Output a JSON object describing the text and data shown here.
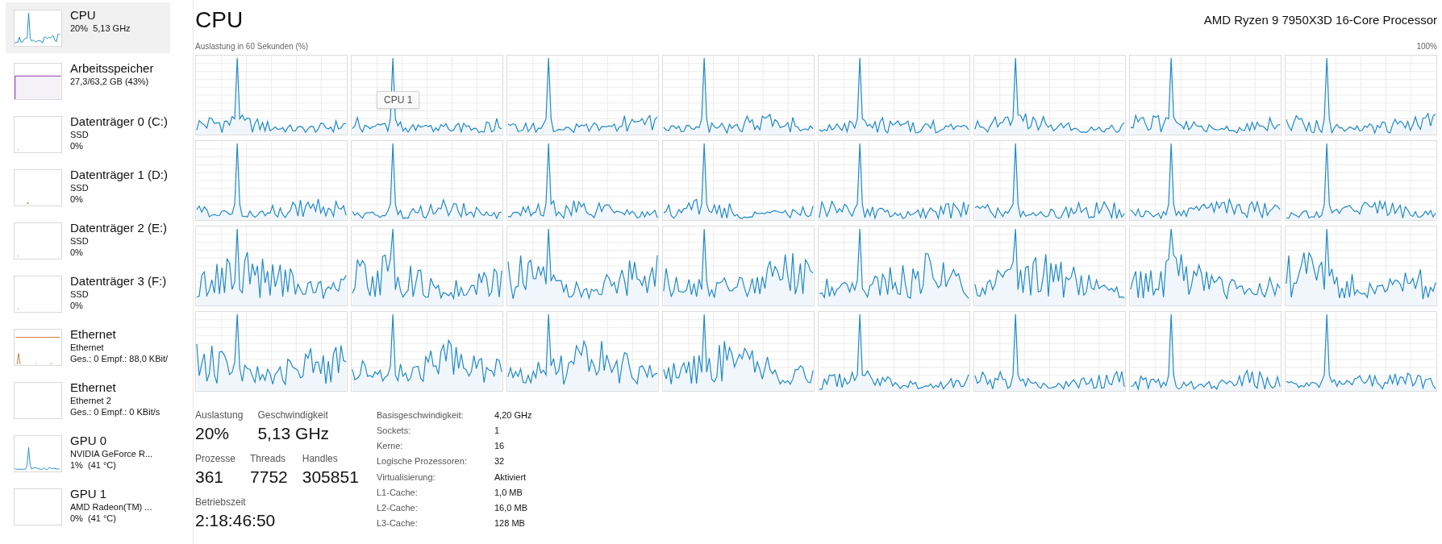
{
  "sidebar": {
    "items": [
      {
        "kind": "cpu",
        "title": "CPU",
        "lines": [
          "20%  5,13 GHz"
        ],
        "selected": true
      },
      {
        "kind": "memory",
        "title": "Arbeitsspeicher",
        "lines": [
          "27,3/63,2 GB (43%)"
        ],
        "selected": false
      },
      {
        "kind": "disk",
        "title": "Datenträger 0 (C:)",
        "lines": [
          "SSD",
          "0%"
        ],
        "selected": false
      },
      {
        "kind": "disk-blip",
        "title": "Datenträger 1 (D:)",
        "lines": [
          "SSD",
          "0%"
        ],
        "selected": false
      },
      {
        "kind": "disk",
        "title": "Datenträger 2 (E:)",
        "lines": [
          "SSD",
          "0%"
        ],
        "selected": false
      },
      {
        "kind": "disk",
        "title": "Datenträger 3 (F:)",
        "lines": [
          "SSD",
          "0%"
        ],
        "selected": false
      },
      {
        "kind": "network",
        "title": "Ethernet",
        "lines": [
          "Ethernet",
          "Ges.: 0 Empf.: 88,0 KBit/"
        ],
        "selected": false
      },
      {
        "kind": "idle",
        "title": "Ethernet",
        "lines": [
          "Ethernet 2",
          "Ges.: 0 Empf.: 0 KBit/s"
        ],
        "selected": false
      },
      {
        "kind": "gpu",
        "title": "GPU 0",
        "lines": [
          "NVIDIA GeForce R...",
          "1%  (41 °C)"
        ],
        "selected": false
      },
      {
        "kind": "idle",
        "title": "GPU 1",
        "lines": [
          "AMD Radeon(TM) ...",
          "0%  (41 °C)"
        ],
        "selected": false
      }
    ]
  },
  "header": {
    "title": "CPU",
    "processor": "AMD Ryzen 9 7950X3D 16-Core Processor",
    "graph_caption": "Auslastung in 60 Sekunden (%)",
    "graph_max": "100%"
  },
  "core_graphs": [
    {
      "kind": "light"
    },
    {
      "kind": "light",
      "tooltip": "CPU 1"
    },
    {
      "kind": "light"
    },
    {
      "kind": "light"
    },
    {
      "kind": "light"
    },
    {
      "kind": "light"
    },
    {
      "kind": "light"
    },
    {
      "kind": "light"
    },
    {
      "kind": "light"
    },
    {
      "kind": "light"
    },
    {
      "kind": "light"
    },
    {
      "kind": "light"
    },
    {
      "kind": "light"
    },
    {
      "kind": "light"
    },
    {
      "kind": "light"
    },
    {
      "kind": "light"
    },
    {
      "kind": "heavy"
    },
    {
      "kind": "heavy"
    },
    {
      "kind": "heavy"
    },
    {
      "kind": "heavy"
    },
    {
      "kind": "heavy"
    },
    {
      "kind": "heavy"
    },
    {
      "kind": "heavy"
    },
    {
      "kind": "heavy"
    },
    {
      "kind": "heavy"
    },
    {
      "kind": "heavy"
    },
    {
      "kind": "heavy"
    },
    {
      "kind": "heavy"
    },
    {
      "kind": "light"
    },
    {
      "kind": "light"
    },
    {
      "kind": "light"
    },
    {
      "kind": "light"
    }
  ],
  "stats": {
    "rows": [
      [
        {
          "label": "Auslastung",
          "value": "20%"
        },
        {
          "label": "Geschwindigkeit",
          "value": "5,13 GHz"
        }
      ],
      [
        {
          "label": "Prozesse",
          "value": "361"
        },
        {
          "label": "Threads",
          "value": "7752"
        },
        {
          "label": "Handles",
          "value": "305851"
        }
      ],
      [
        {
          "label": "Betriebszeit",
          "value": "2:18:46:50"
        }
      ]
    ],
    "details": [
      {
        "label": "Basisgeschwindigkeit:",
        "value": "4,20 GHz"
      },
      {
        "label": "Sockets:",
        "value": "1"
      },
      {
        "label": "Kerne:",
        "value": "16"
      },
      {
        "label": "Logische Prozessoren:",
        "value": "32"
      },
      {
        "label": "Virtualisierung:",
        "value": "Aktiviert"
      },
      {
        "label": "L1-Cache:",
        "value": "1,0 MB"
      },
      {
        "label": "L2-Cache:",
        "value": "16,0 MB"
      },
      {
        "label": "L3-Cache:",
        "value": "128 MB"
      }
    ]
  }
}
